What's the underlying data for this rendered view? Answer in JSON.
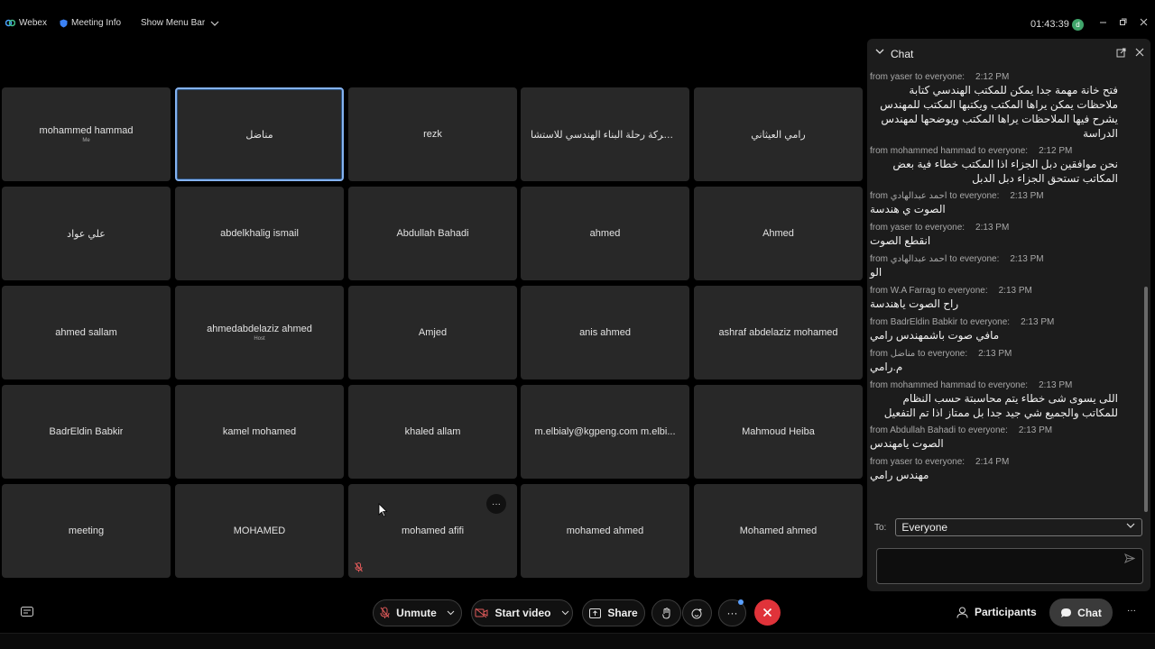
{
  "topbar": {
    "app_name": "Webex",
    "meeting_info": "Meeting Info",
    "show_menu_bar": "Show Menu Bar",
    "clock": "01:43:39",
    "avatar_letter": "d"
  },
  "tiles": [
    {
      "name": "mohammed hammad",
      "sub": "Me"
    },
    {
      "name": "مناضل",
      "sub": ""
    },
    {
      "name": "rezk",
      "sub": ""
    },
    {
      "name": "شركة رحلة البناء الهندسي للاستشا...",
      "sub": ""
    },
    {
      "name": "رامي العيثاني",
      "sub": ""
    },
    {
      "name": "علي عواد",
      "sub": ""
    },
    {
      "name": "abdelkhalig ismail",
      "sub": ""
    },
    {
      "name": "Abdullah Bahadi",
      "sub": ""
    },
    {
      "name": "ahmed",
      "sub": ""
    },
    {
      "name": "Ahmed",
      "sub": ""
    },
    {
      "name": "ahmed sallam",
      "sub": ""
    },
    {
      "name": "ahmedabdelaziz ahmed",
      "sub": "Host"
    },
    {
      "name": "Amjed",
      "sub": ""
    },
    {
      "name": "anis ahmed",
      "sub": ""
    },
    {
      "name": "ashraf abdelaziz mohamed",
      "sub": ""
    },
    {
      "name": "BadrEldin Babkir",
      "sub": ""
    },
    {
      "name": "kamel mohamed",
      "sub": ""
    },
    {
      "name": "khaled allam",
      "sub": ""
    },
    {
      "name": "m.elbialy@kgpeng.com m.elbi...",
      "sub": ""
    },
    {
      "name": "Mahmoud Heiba",
      "sub": ""
    },
    {
      "name": "meeting",
      "sub": ""
    },
    {
      "name": "MOHAMED",
      "sub": ""
    },
    {
      "name": "mohamed afifi",
      "sub": ""
    },
    {
      "name": "mohamed ahmed",
      "sub": ""
    },
    {
      "name": "Mohamed ahmed",
      "sub": ""
    }
  ],
  "tile_more": "···",
  "chat": {
    "title": "Chat",
    "messages": [
      {
        "from": "from yaser to everyone:",
        "time": "2:12 PM",
        "text": "فتح خانة مهمة جدا يمكن للمكتب الهندسي كتابة ملاحظات يمكن يراها المكتب ويكتبها المكتب للمهندس يشرح فيها الملاحظات يراها المكتب ويوضحها لمهندس الدراسة"
      },
      {
        "from": "from mohammed hammad to everyone:",
        "time": "2:12 PM",
        "text": "نحن موافقين دبل الجزاء اذا المكتب خطاء فية بعض المكاتب تستحق الجزاء دبل الدبل"
      },
      {
        "from": "from احمد عبدالهادي to everyone:",
        "time": "2:13 PM",
        "text": "الصوت ي هندسة"
      },
      {
        "from": "from yaser to everyone:",
        "time": "2:13 PM",
        "text": "انقطع الصوت"
      },
      {
        "from": "from احمد عبدالهادي to everyone:",
        "time": "2:13 PM",
        "text": "الو"
      },
      {
        "from": "from W.A Farrag to everyone:",
        "time": "2:13 PM",
        "text": "راح الصوت ياهندسة"
      },
      {
        "from": "from BadrEldin Babkir to everyone:",
        "time": "2:13 PM",
        "text": "مافي صوت باشمهندس رامي"
      },
      {
        "from": "from مناضل to everyone:",
        "time": "2:13 PM",
        "text": "م.رامي"
      },
      {
        "from": "from mohammed hammad to everyone:",
        "time": "2:13 PM",
        "text": "اللى يسوى شى خطاء يتم محاسبتة حسب النظام للمكاتب والجميع شي جيد جدا بل ممتاز اذا تم التفعيل"
      },
      {
        "from": "from Abdullah Bahadi to everyone:",
        "time": "2:13 PM",
        "text": "الصوت يامهندس"
      },
      {
        "from": "from yaser to everyone:",
        "time": "2:14 PM",
        "text": "مهندس رامي"
      }
    ],
    "to_label": "To:",
    "to_value": "Everyone"
  },
  "toolbar": {
    "unmute": "Unmute",
    "start_video": "Start video",
    "share": "Share",
    "more": "···",
    "participants": "Participants",
    "chat": "Chat",
    "overflow": "···"
  },
  "colors": {
    "active_tile_border": "#84b2f0",
    "end_call": "#e0333a",
    "muted_icon": "#e05a5a",
    "notification_dot": "#5aa0ff",
    "avatar": "#3fa46a"
  }
}
